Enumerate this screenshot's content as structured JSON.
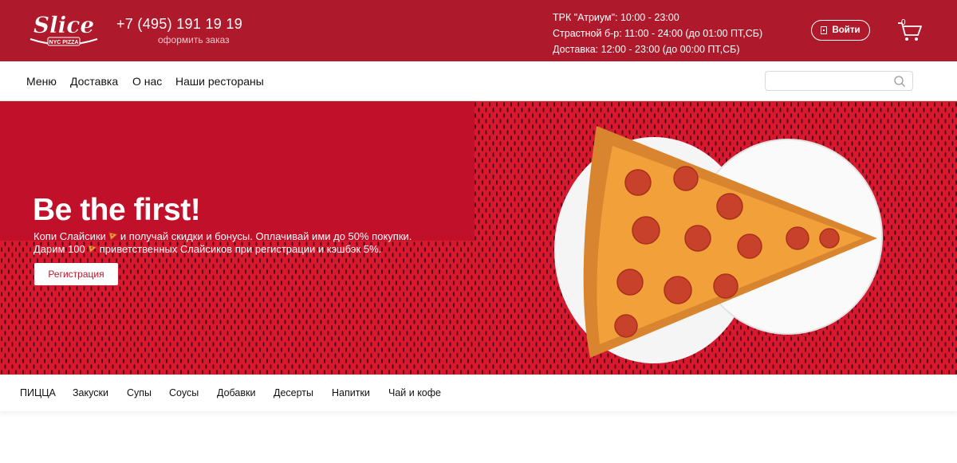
{
  "header": {
    "logo_text": "Slice",
    "logo_sub": "NYC PIZZA",
    "phone": "+7 (495) 191 19 19",
    "order_link": "оформить заказ",
    "hours": [
      "ТРК \"Атриум\": 10:00 - 23:00",
      "Страстной б-р: 11:00 - 24:00 (до 01:00 ПТ,СБ)",
      "Доставка: 12:00 - 23:00 (до 00:00 ПТ,СБ)"
    ],
    "login_label": "Войти",
    "cart_count": "0"
  },
  "nav": {
    "items": [
      "Меню",
      "Доставка",
      "О нас",
      "Наши рестораны"
    ],
    "search_placeholder": ""
  },
  "hero": {
    "title": "Be the first!",
    "line1_a": "Копи Слайсики",
    "line1_b": "и получай скидки и бонусы. Оплачивай ими до 50% покупки.",
    "line2_a": "Дарим 100",
    "line2_b": "приветственных Слайсиков при регистрации и кэшбэк 5%.",
    "register_label": "Регистрация"
  },
  "categories": [
    "ПИЦЦА",
    "Закуски",
    "Супы",
    "Соусы",
    "Добавки",
    "Десерты",
    "Напитки",
    "Чай и кофе"
  ],
  "colors": {
    "brand": "#ae1a2b",
    "hero_bg": "#c0102a",
    "pattern_bg": "#d8182f"
  }
}
